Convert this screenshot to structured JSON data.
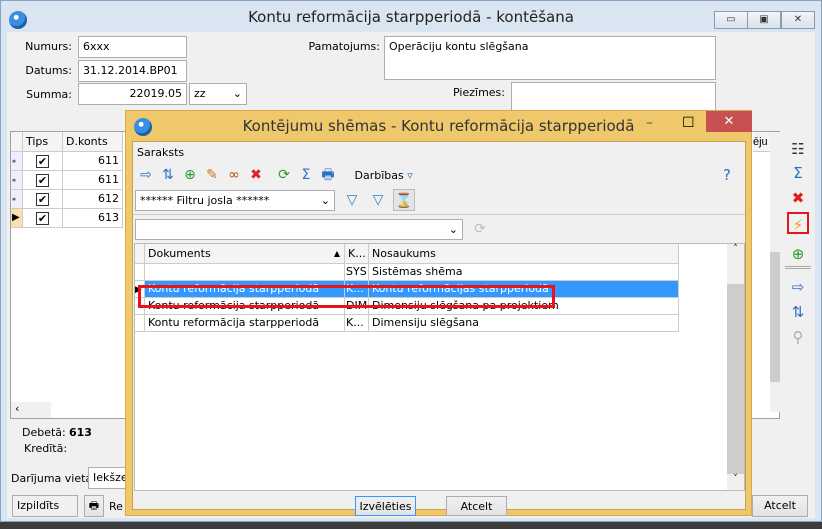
{
  "main": {
    "title": "Kontu reformācija starpperiodā - kontēšana",
    "fields": {
      "numurs_label": "Numurs:",
      "numurs": "6xxx",
      "datums_label": "Datums:",
      "datums": "31.12.2014.BP01",
      "summa_label": "Summa:",
      "summa": "22019.05",
      "currency": "zz",
      "pamatojums_label": "Pamatojums:",
      "pamatojums": "Operāciju kontu slēgšana",
      "piezimes_label": "Piezīmes:"
    },
    "grid": {
      "headers": [
        "Tips",
        "D.konts"
      ],
      "rows": [
        {
          "dkonts": "611",
          "checked": true
        },
        {
          "dkonts": "611",
          "checked": true
        },
        {
          "dkonts": "612",
          "checked": true
        },
        {
          "dkonts": "613",
          "checked": true
        }
      ],
      "right_header_fragment": "ēju"
    },
    "totals": {
      "debeta_label": "Debetā:",
      "debeta": "613",
      "kredita_label": "Kredītā:"
    },
    "darijuma_vieta_label": "Darījuma vieta:",
    "darijuma_vieta": "Iekšze",
    "status": "Izpildīts",
    "report_fragment": "Re",
    "cancel": "Atcelt"
  },
  "dialog": {
    "title": "Kontējumu shēmas - Kontu reformācija starpperiodā",
    "menu": "Saraksts",
    "actions_label": "Darbības",
    "filter_bar": "****** Filtru josla ******",
    "columns": [
      "Dokuments",
      "K...",
      "Nosaukums"
    ],
    "rows": [
      {
        "doc": "",
        "k": "SYS",
        "name": "Sistēmas shēma"
      },
      {
        "doc": "Kontu reformācija starpperiodā",
        "k": "K...",
        "name": "Kontu reformācijas starpperiodā"
      },
      {
        "doc": "Kontu reformācija starpperiodā",
        "k": "DIM",
        "name": "Dimensiju slēgšana pa projektiem"
      },
      {
        "doc": "Kontu reformācija starpperiodā",
        "k": "K...",
        "name": "Dimensiju slēgšana"
      }
    ],
    "select_button": "Izvēlēties",
    "cancel_button": "Atcelt"
  },
  "colors": {
    "dialog_title": "#f0c86c",
    "selection": "#3399ff",
    "highlight": "#e8141c"
  }
}
